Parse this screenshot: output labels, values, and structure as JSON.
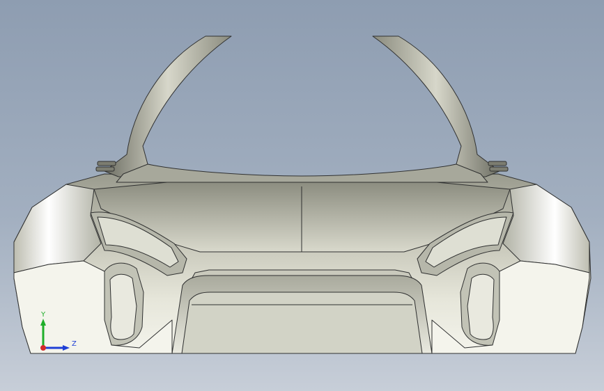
{
  "viewport": {
    "background_top": "#8e9db1",
    "background_bottom": "#c7ced8"
  },
  "model": {
    "body_color": "#cfcfc2",
    "edge_color": "#2f3030"
  },
  "triad": {
    "x_label": "",
    "y_label": "Y",
    "z_label": "Z",
    "x_color": "#d32a2a",
    "y_color": "#1fae2a",
    "z_color": "#1f3fd6"
  }
}
